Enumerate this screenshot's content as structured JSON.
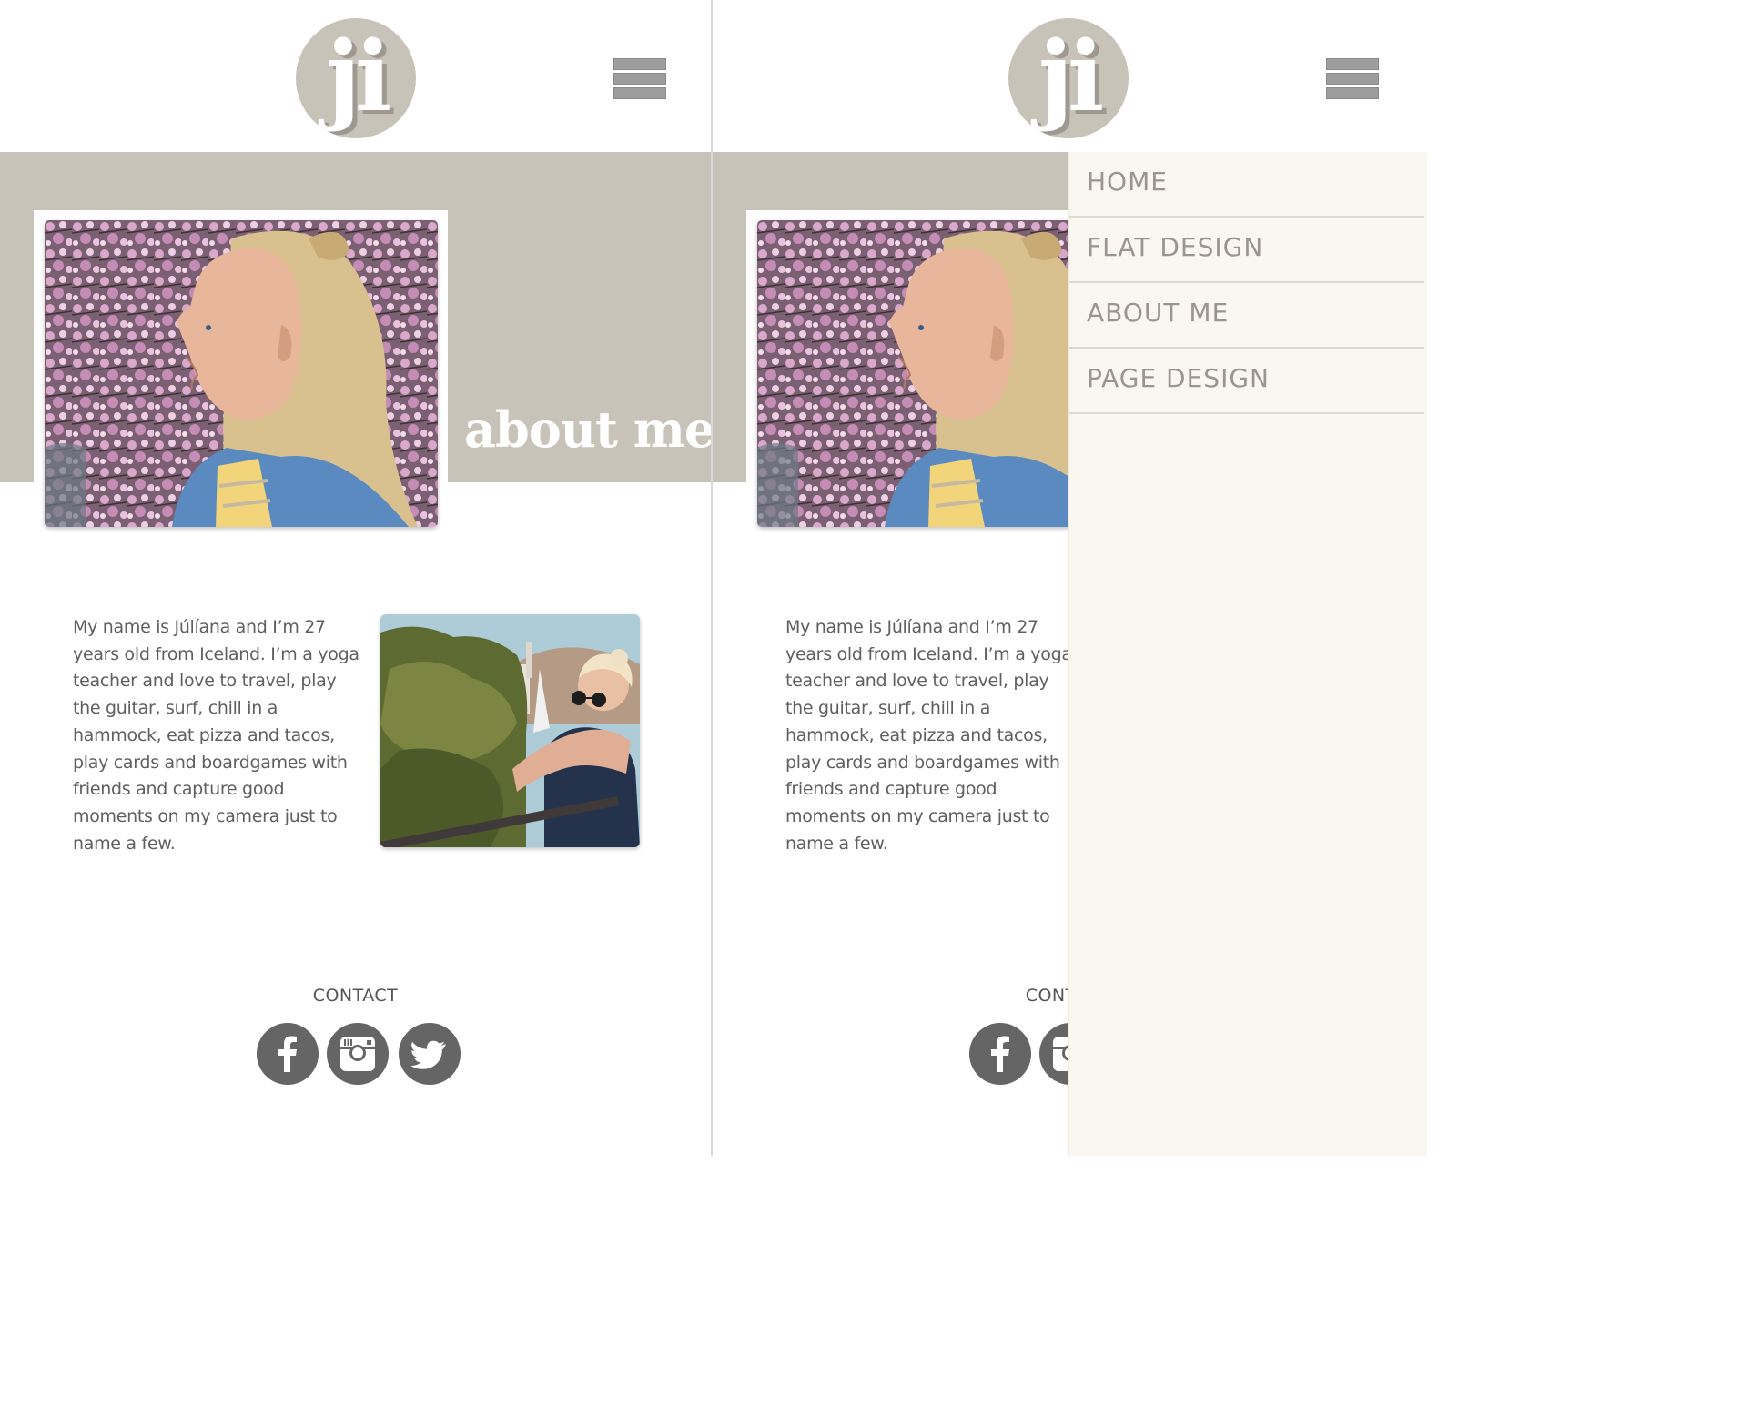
{
  "logo": {
    "text": "ji"
  },
  "about": {
    "title": "about me"
  },
  "bio": {
    "text": "My name is Júlíana and I’m 27 years old from Iceland. I’m a yoga teacher and love to travel, play the guitar, surf, chill in a hammock, eat pizza and tacos, play cards and boardgames with friends and capture good moments on my camera just to name a few."
  },
  "contact": {
    "label": "CONTACT"
  },
  "social": [
    {
      "name": "facebook",
      "icon": "facebook-icon"
    },
    {
      "name": "instagram",
      "icon": "instagram-icon"
    },
    {
      "name": "twitter",
      "icon": "twitter-icon"
    }
  ],
  "menu": {
    "items": [
      {
        "label": "HOME"
      },
      {
        "label": "FLAT DESIGN"
      },
      {
        "label": "ABOUT ME"
      },
      {
        "label": "PAGE DESIGN"
      }
    ]
  },
  "colors": {
    "accent": "#c7c3b9",
    "drawer": "#faf7f1",
    "text": "#5f5f5f",
    "social": "#666565",
    "menu_text": "#9a968f"
  }
}
